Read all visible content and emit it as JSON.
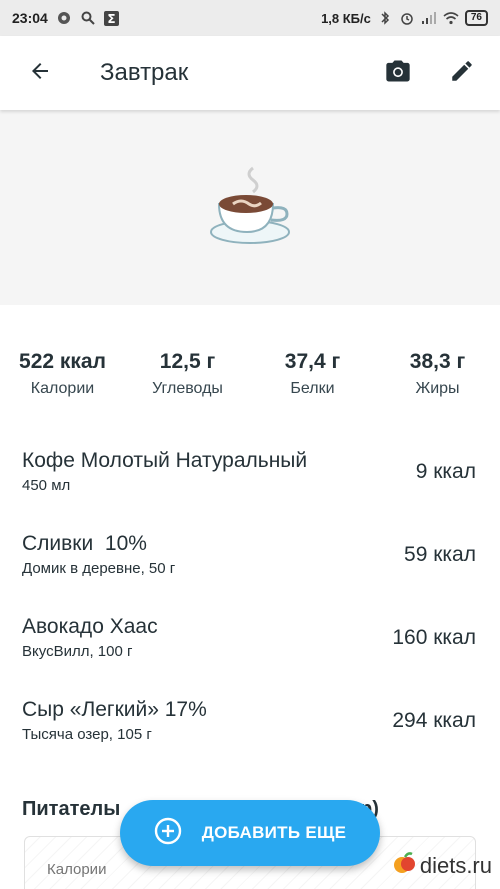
{
  "status_bar": {
    "time": "23:04",
    "speed": "1,8 КБ/с",
    "battery": "76"
  },
  "app_bar": {
    "title": "Завтрак"
  },
  "summary": [
    {
      "value": "522 ккал",
      "label": "Калории"
    },
    {
      "value": "12,5 г",
      "label": "Углеводы"
    },
    {
      "value": "37,4 г",
      "label": "Белки"
    },
    {
      "value": "38,3 г",
      "label": "Жиры"
    }
  ],
  "foods": [
    {
      "name": "Кофе Молотый Натуральный",
      "detail": "450 мл",
      "kcal": "9 ккал"
    },
    {
      "name": "Сливки  10%",
      "detail": "Домик в деревне, 50 г",
      "kcal": "59 ккал"
    },
    {
      "name": "Авокадо Хаас",
      "detail": "ВкусВилл, 100 г",
      "kcal": "160 ккал"
    },
    {
      "name": "Сыр «Легкий» 17%",
      "detail": "Тысяча озер, 105 г",
      "kcal": "294 ккал"
    }
  ],
  "nutrition": {
    "title_visible_start": "Питателы",
    "title_visible_end": "р)",
    "chart_label": "Калории"
  },
  "fab": {
    "label": "ДОБАВИТЬ ЕЩЕ"
  },
  "watermark": {
    "text": "diets.ru"
  },
  "colors": {
    "accent": "#29a8f0",
    "text": "#263238",
    "hero_bg": "#f5f5f5"
  }
}
